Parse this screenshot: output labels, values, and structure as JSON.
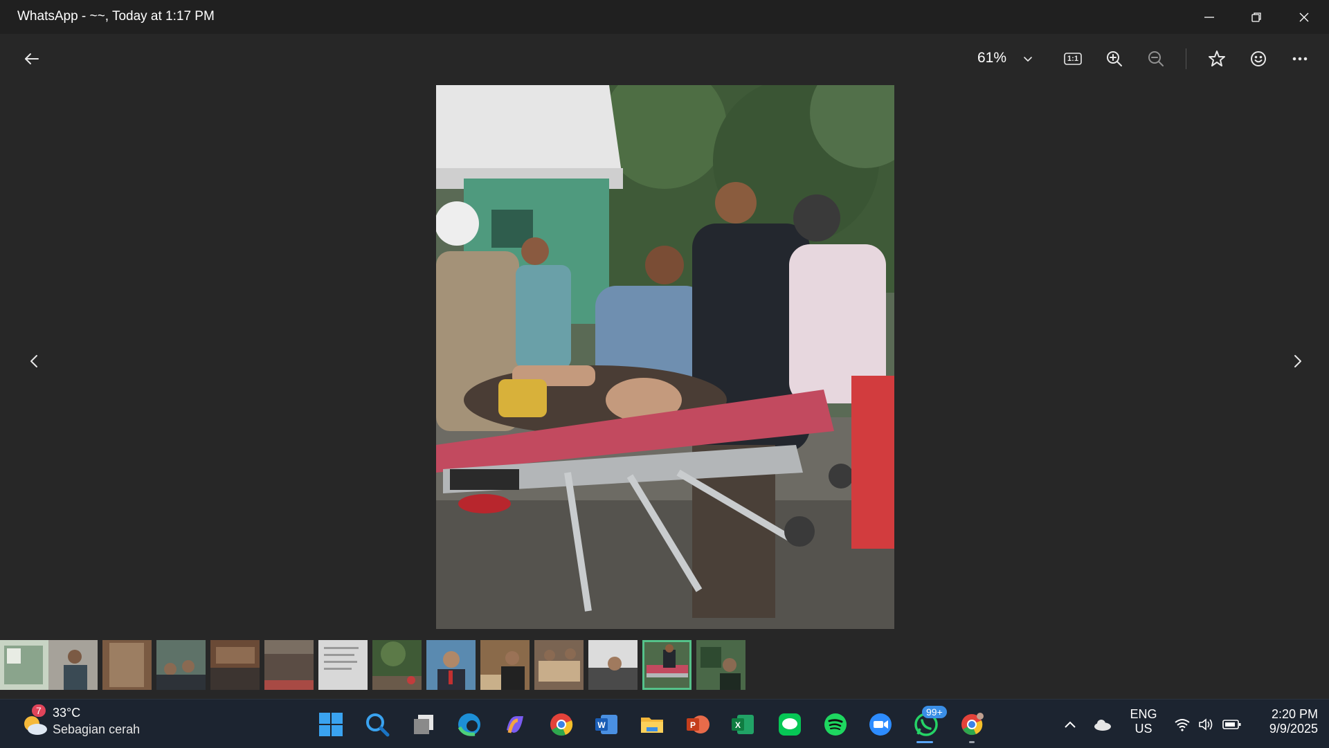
{
  "window": {
    "title": "WhatsApp - ~~, Today at 1:17 PM"
  },
  "toolbar": {
    "zoom_value": "61%",
    "ratio_label": "1:1"
  },
  "photo": {
    "description_icon": "photo-image"
  },
  "thumbnails": {
    "count": 14,
    "active_index": 12
  },
  "taskbar": {
    "weather": {
      "badge": "7",
      "temperature": "33°C",
      "description": "Sebagian cerah"
    },
    "whatsapp_badge": "99+",
    "language": {
      "line1": "ENG",
      "line2": "US"
    },
    "clock": {
      "time": "2:20 PM",
      "date": "9/9/2025"
    }
  },
  "colors": {
    "background": "#272727",
    "titlebar": "#202020",
    "taskbar": "#1c2430",
    "active_thumb": "#55c28a"
  }
}
